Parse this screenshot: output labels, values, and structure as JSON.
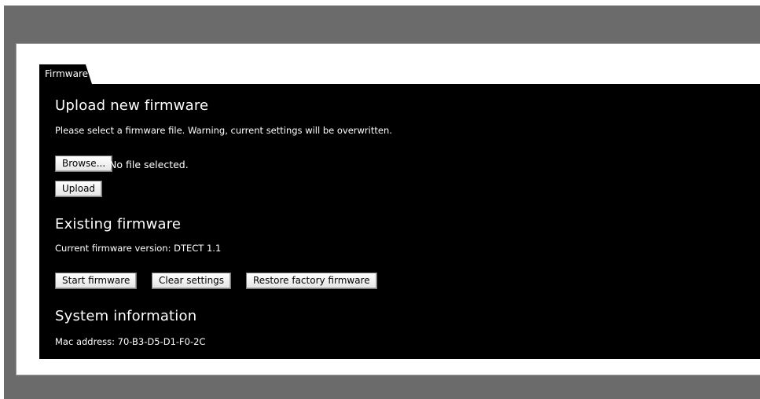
{
  "tab": {
    "label": "Firmware"
  },
  "upload": {
    "title": "Upload new firmware",
    "description": "Please select a firmware file. Warning, current settings will be overwritten.",
    "browse_label": "Browse...",
    "file_status": "No file selected.",
    "upload_label": "Upload"
  },
  "existing": {
    "title": "Existing firmware",
    "version_text": "Current firmware version: DTECT 1.1",
    "start_label": "Start firmware",
    "clear_label": "Clear settings",
    "restore_label": "Restore factory firmware"
  },
  "system": {
    "title": "System information",
    "mac_text": "Mac address: 70-B3-D5-D1-F0-2C"
  }
}
